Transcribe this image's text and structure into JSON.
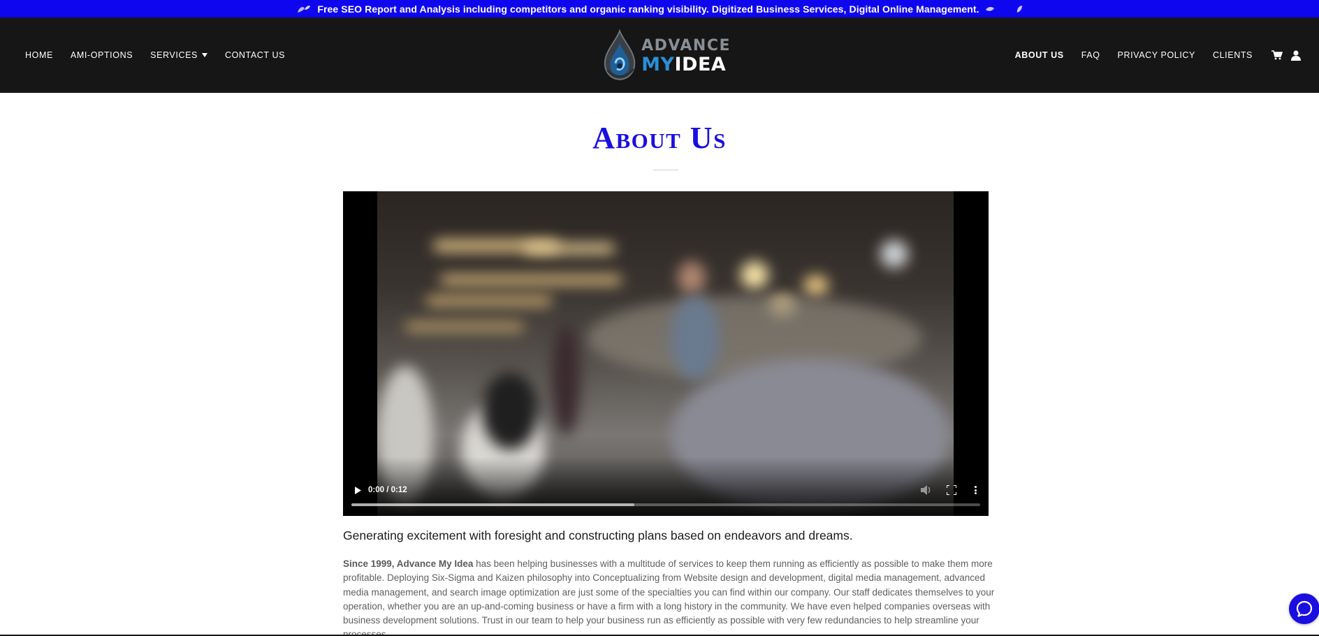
{
  "announcement": {
    "text": "Free SEO Report and Analysis including competitors and organic ranking visibility. Digitized Business Services, Digital Online Management."
  },
  "header": {
    "nav_left": [
      {
        "label": "HOME"
      },
      {
        "label": "AMI-OPTIONS"
      },
      {
        "label": "SERVICES",
        "has_dropdown": true
      },
      {
        "label": "CONTACT US"
      }
    ],
    "nav_right": [
      {
        "label": "ABOUT US",
        "active": true
      },
      {
        "label": "FAQ"
      },
      {
        "label": "PRIVACY POLICY"
      },
      {
        "label": "CLIENTS"
      }
    ],
    "logo": {
      "line1": "ADVANCE",
      "line2_a": "MY",
      "line2_b": "IDEA"
    },
    "icons": [
      "cart-icon",
      "user-icon"
    ]
  },
  "main": {
    "title": "About Us",
    "video": {
      "time": "0:00 / 0:12",
      "buffered_fraction": 0.45
    },
    "lead": "Generating excitement with foresight and constructing plans based on endeavors and dreams.",
    "body_bold": "Since 1999, Advance My Idea",
    "body_rest": " has been helping businesses with a multitude of services to keep them running as efficiently as possible to make them more profitable. Deploying Six-Sigma and Kaizen philosophy into Conceptualizing from Website design and development, digital media management, advanced media management, and search image optimization are just some of the specialties you can find within our company. Our staff dedicates themselves to your operation, whether you are an up-and-coming business or have a firm with a long history in the community. We have even helped companies overseas with business development solutions. Trust in our team to help your business run as efficiently as possible with very few redundancies to help streamline your processes."
  },
  "colors": {
    "accent": "#1a0fe0",
    "announce_bg": "#0f06f0",
    "header_bg": "#161616"
  }
}
